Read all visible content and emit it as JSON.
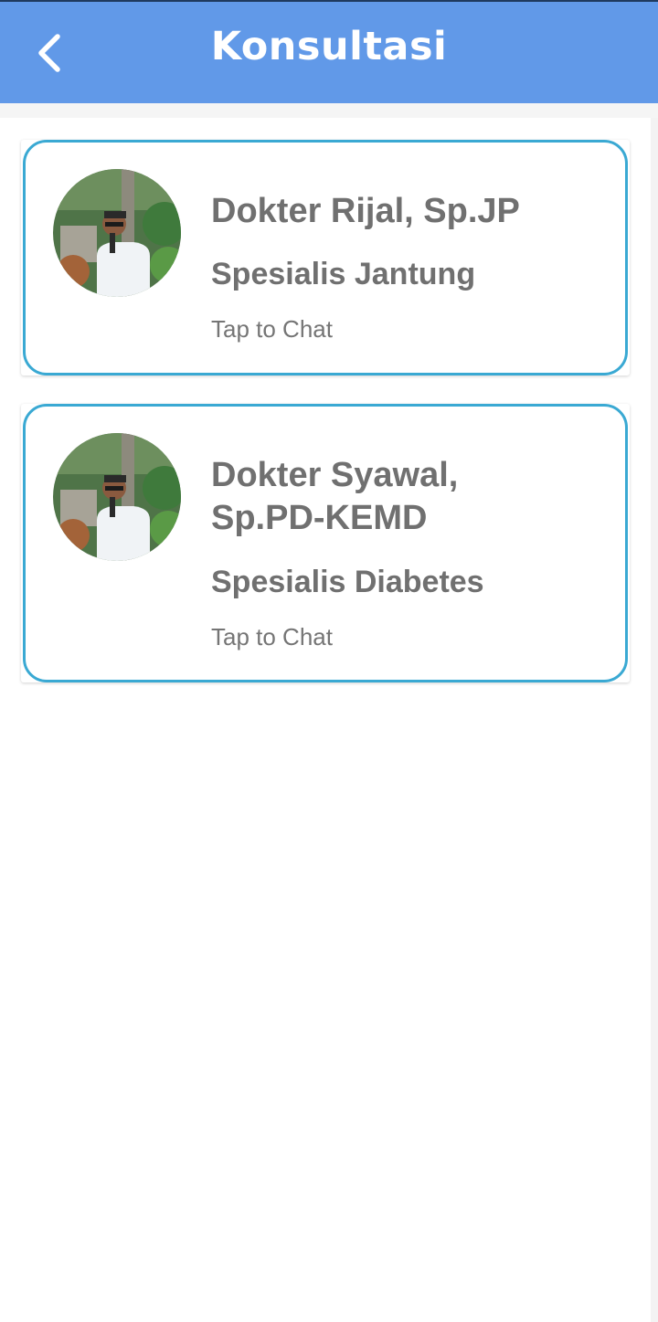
{
  "appbar": {
    "title": "Konsultasi",
    "back_icon": "chevron-left-icon",
    "background": "#6199e8"
  },
  "accent": "#3aa9d3",
  "doctors": [
    {
      "name": "Dokter Rijal, Sp.JP",
      "specialty": "Spesialis Jantung",
      "action": "Tap to Chat"
    },
    {
      "name": "Dokter Syawal, Sp.PD-KEMD",
      "specialty": "Spesialis Diabetes",
      "action": "Tap to Chat"
    }
  ]
}
